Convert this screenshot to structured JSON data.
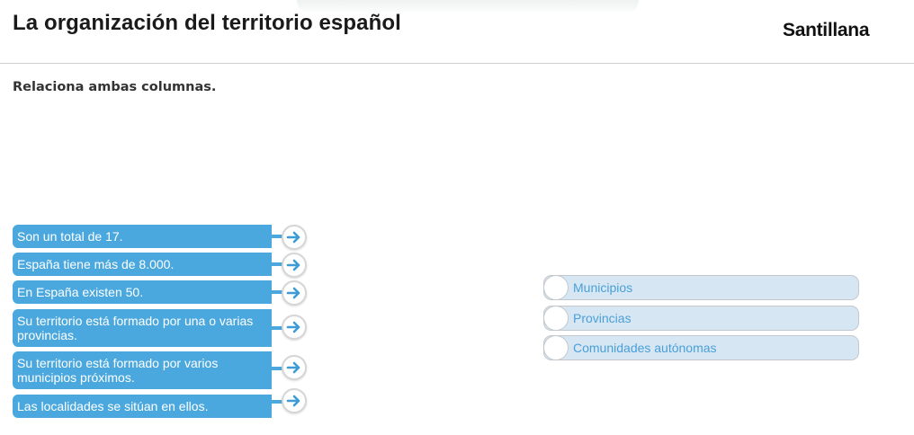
{
  "header": {
    "title": "La organización del territorio español",
    "logo_text": "Santillana"
  },
  "instruction": "Relaciona ambas columnas.",
  "left_items": [
    {
      "text": "Son un total de 17."
    },
    {
      "text": "España tiene más de 8.000."
    },
    {
      "text": "En España existen 50."
    },
    {
      "text": "Su territorio está formado por una o varias provincias."
    },
    {
      "text": "Su territorio está formado por varios municipios próximos."
    },
    {
      "text": "Las localidades se sitúan en ellos."
    }
  ],
  "right_items": [
    {
      "text": "Municipios"
    },
    {
      "text": "Provincias"
    },
    {
      "text": "Comunidades autónomas"
    }
  ],
  "colors": {
    "accent_blue": "#4aa8de",
    "option_bg": "#d6e7f3",
    "option_text": "#4a9fd8",
    "arrow_icon": "#3d9bd6"
  },
  "icons": {
    "arrow": "arrow-right-icon"
  }
}
